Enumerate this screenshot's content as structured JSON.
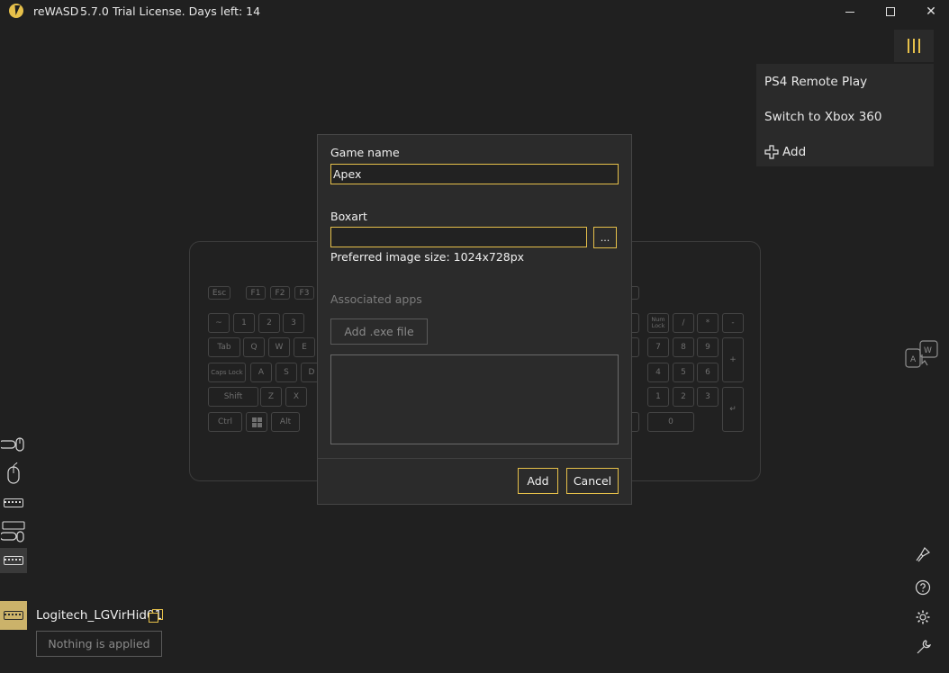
{
  "window": {
    "app_name": "reWASD",
    "version": "5.7.0",
    "license": "Trial License. Days left: 14",
    "close_glyph": "✕"
  },
  "profile_menu": {
    "items": [
      "PS4 Remote Play",
      "Switch to Xbox 360"
    ],
    "add_label": "Add"
  },
  "keyboard": {
    "row0": [
      "Esc",
      "F1",
      "F2",
      "F3"
    ],
    "row1": [
      "~",
      "1",
      "2",
      "3"
    ],
    "row2": [
      "Tab",
      "Q",
      "W",
      "E"
    ],
    "row3": [
      "Caps Lock",
      "A",
      "S",
      "D"
    ],
    "row4": [
      "Shift",
      "Z",
      "X"
    ],
    "row5": [
      "Ctrl",
      "Alt"
    ],
    "numpad": {
      "numlock": "Num Lock",
      "div": "/",
      "mul": "*",
      "sub": "-",
      "n7": "7",
      "n8": "8",
      "n9": "9",
      "plus": "+",
      "n4": "4",
      "n5": "5",
      "n6": "6",
      "n1": "1",
      "n2": "2",
      "n3": "3",
      "enter": "↵",
      "n0": "0"
    }
  },
  "dialog": {
    "game_name_label": "Game name",
    "game_name_value": "Apex",
    "boxart_label": "Boxart",
    "boxart_value": "",
    "browse_label": "...",
    "hint": "Preferred image size: 1024x728px",
    "associated_apps_label": "Associated apps",
    "add_exe_label": "Add .exe file",
    "add_button": "Add",
    "cancel_button": "Cancel"
  },
  "device": {
    "name": "Logitech_LGVirHid01",
    "status": "Nothing is applied"
  },
  "icons": {
    "accent": "#e6c04a",
    "sidebar": [
      "gamepad-mouse-icon",
      "mouse-icon",
      "keyboard-icon",
      "gamepad-keyboard-icon",
      "keyboard-icon"
    ],
    "right": [
      "clean-icon",
      "help-icon",
      "settings-icon",
      "tools-icon"
    ]
  }
}
